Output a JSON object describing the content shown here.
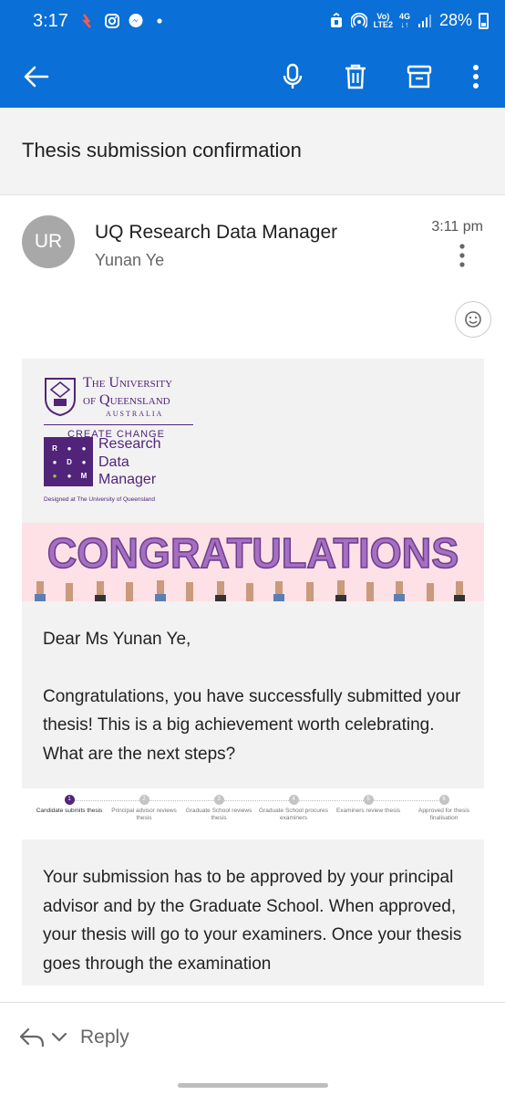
{
  "status_bar": {
    "time": "3:17",
    "network_top": "4G",
    "volte": "Vo)",
    "lte": "LTE2",
    "battery": "28%"
  },
  "app_bar": {
    "back_icon": "arrow-left-icon",
    "actions": [
      "microphone-icon",
      "trash-icon",
      "archive-icon",
      "more-vert-icon"
    ]
  },
  "subject": "Thesis submission confirmation",
  "sender": {
    "initials": "UR",
    "name": "UQ Research Data Manager",
    "recipient": "Yunan Ye",
    "time": "3:11 pm"
  },
  "email": {
    "uq_name_line1": "The University",
    "uq_name_line2": "of Queensland",
    "uq_country": "AUSTRALIA",
    "uq_tagline": "CREATE CHANGE",
    "rdm_letters": [
      "R",
      "D",
      "M"
    ],
    "rdm_line1": "Research",
    "rdm_line2": "Data",
    "rdm_line3": "Manager",
    "rdm_designed": "Designed at The University of Queensland",
    "banner_text": "CONGRATULATIONS",
    "greeting": "Dear Ms Yunan Ye,",
    "intro": "Congratulations, you have successfully submitted your thesis! This is a big achievement worth celebrating. What are the next steps?",
    "steps": [
      {
        "num": "1",
        "label": "Candidate submits thesis",
        "active": true
      },
      {
        "num": "2",
        "label": "Principal advisor reviews thesis",
        "active": false
      },
      {
        "num": "3",
        "label": "Graduate School reviews thesis",
        "active": false
      },
      {
        "num": "4",
        "label": "Graduate School procures examiners",
        "active": false
      },
      {
        "num": "5",
        "label": "Examiners review thesis",
        "active": false
      },
      {
        "num": "6",
        "label": "Approved for thesis finalisation",
        "active": false
      }
    ],
    "next_para": "Your submission has to be approved by your principal advisor and by the Graduate School. When approved, your thesis will go to your examiners. Once your thesis goes through the examination"
  },
  "bottom_bar": {
    "reply_label": "Reply"
  }
}
